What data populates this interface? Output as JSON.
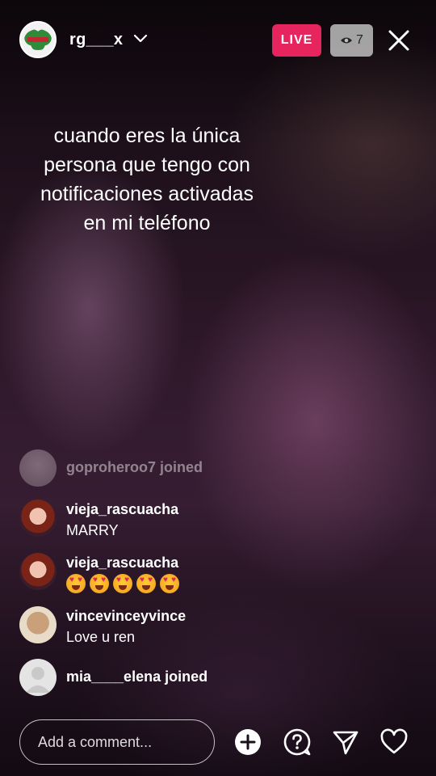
{
  "header": {
    "host_name": "rg___x",
    "live_label": "LIVE",
    "viewer_count": "7"
  },
  "caption": {
    "lines": [
      "cuando eres la única",
      "persona que tengo con",
      "notificaciones activadas",
      "en mi teléfono"
    ]
  },
  "comments": [
    {
      "type": "joined",
      "user": "goproheroo7",
      "action": "joined"
    },
    {
      "type": "comment",
      "user": "vieja_rascuacha",
      "text": "MARRY"
    },
    {
      "type": "emoji",
      "user": "vieja_rascuacha",
      "emoji": "heart-eyes",
      "count": 5
    },
    {
      "type": "comment",
      "user": "vincevinceyvince",
      "text": "Love u ren"
    },
    {
      "type": "joined",
      "user": "mia____elena",
      "action": "joined"
    }
  ],
  "bottom_bar": {
    "comment_placeholder": "Add a comment..."
  },
  "colors": {
    "live_badge": "#e6245e",
    "viewer_badge": "#bebebe"
  }
}
